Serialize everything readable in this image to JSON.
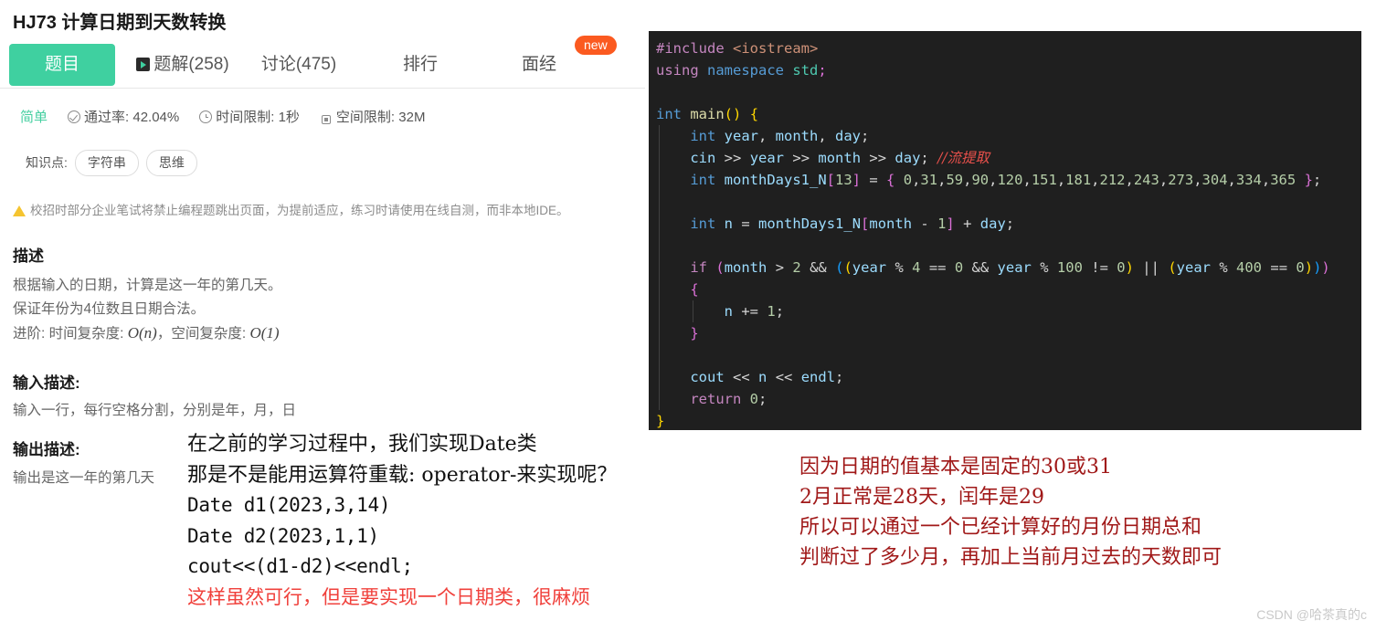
{
  "problem": {
    "id": "HJ73",
    "title": "计算日期到天数转换",
    "full_title": "HJ73  计算日期到天数转换"
  },
  "tabs": [
    {
      "label": "题目",
      "active": true,
      "icon": null
    },
    {
      "label": "题解(258)",
      "active": false,
      "icon": "play-icon"
    },
    {
      "label": "讨论(475)",
      "active": false,
      "icon": null
    },
    {
      "label": "排行",
      "active": false,
      "icon": null
    },
    {
      "label": "面经",
      "active": false,
      "icon": null
    }
  ],
  "badge": {
    "label": "new",
    "color": "#FB5A20"
  },
  "meta": {
    "difficulty": "简单",
    "difficulty_color": "#45CFA0",
    "pass_rate": "通过率: 42.04%",
    "time_limit": "时间限制: 1秒",
    "space_limit": "空间限制: 32M"
  },
  "knowledge": {
    "label": "知识点:",
    "tags": [
      "字符串",
      "思维"
    ]
  },
  "notice": "校招时部分企业笔试将禁止编程题跳出页面，为提前适应，练习时请使用在线自测，而非本地IDE。",
  "sections": {
    "description_heading": "描述",
    "description_lines": [
      "根据输入的日期，计算是这一年的第几天。",
      "保证年份为4位数且日期合法。"
    ],
    "advanced_prefix": "进阶: 时间复杂度:",
    "advanced_big_o_n": "O(n)",
    "advanced_mid": "，空间复杂度:",
    "advanced_big_o_1": "O(1)",
    "input_heading": "输入描述:",
    "input_text": "输入一行，每行空格分割，分别是年，月，日",
    "output_heading": "输出描述:",
    "output_text": "输出是这一年的第几天"
  },
  "code": {
    "language": "cpp",
    "background": "#1F1F1F",
    "lines": [
      "#include <iostream>",
      "using namespace std;",
      "",
      "int main() {",
      "    int year, month, day;",
      "    cin >> year >> month >> day; //流提取",
      "    int monthDays1_N[13] = { 0,31,59,90,120,151,181,212,243,273,304,334,365 };",
      "",
      "    int n = monthDays1_N[month - 1] + day;",
      "",
      "    if (month > 2 && ((year % 4 == 0 && year % 100 != 0) || (year % 400 == 0)))",
      "    {",
      "        n += 1;",
      "    }",
      "",
      "    cout << n << endl;",
      "    return 0;",
      "}"
    ],
    "inline_comment": "//流提取"
  },
  "annotations": {
    "left": {
      "color": "#111111",
      "red_color": "#F0413C",
      "lines": [
        "在之前的学习过程中，我们实现Date类",
        "那是不是能用运算符重载: operator-来实现呢？",
        "Date d1(2023,3,14)",
        "Date d2(2023,1,1)",
        "cout<<(d1-d2)<<endl;",
        "这样虽然可行，但是要实现一个日期类，很麻烦"
      ]
    },
    "right": {
      "color": "#A01818",
      "lines": [
        "因为日期的值基本是固定的30或31",
        "2月正常是28天，闰年是29",
        "所以可以通过一个已经计算好的月份日期总和",
        "判断过了多少月，再加上当前月过去的天数即可"
      ]
    }
  },
  "watermark": "CSDN @哈茶真的c"
}
